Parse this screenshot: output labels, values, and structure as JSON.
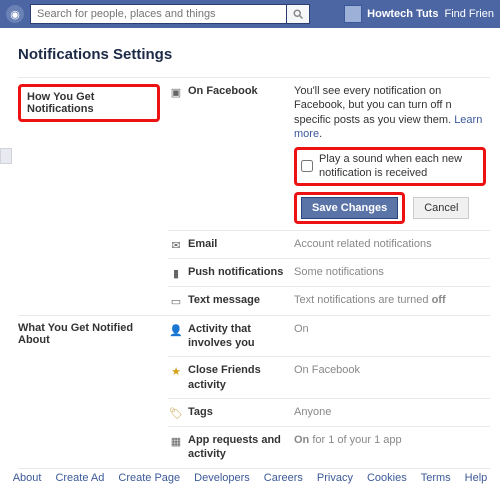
{
  "topbar": {
    "search_placeholder": "Search for people, places and things",
    "username": "Howtech Tuts",
    "find_friends": "Find Frien"
  },
  "page": {
    "title": "Notifications Settings"
  },
  "sections": {
    "how": {
      "title": "How You Get Notifications",
      "rows": {
        "on_fb": {
          "label": "On Facebook",
          "desc_prefix": "You'll see every notification on Facebook, but you can turn off n",
          "desc_suffix": "specific posts as you view them.",
          "learn_more": "Learn more",
          "sound_label": "Play a sound when each new notification is received",
          "save": "Save Changes",
          "cancel": "Cancel"
        },
        "email": {
          "label": "Email",
          "value": "Account related notifications"
        },
        "push": {
          "label": "Push notifications",
          "value": "Some notifications"
        },
        "sms": {
          "label": "Text message",
          "value_prefix": "Text notifications are turned ",
          "value_bold": "off"
        }
      }
    },
    "what": {
      "title": "What You Get Notified About",
      "rows": {
        "activity": {
          "label": "Activity that involves you",
          "value": "On"
        },
        "close_friends": {
          "label": "Close Friends activity",
          "value": "On Facebook"
        },
        "tags": {
          "label": "Tags",
          "value": "Anyone"
        },
        "apps": {
          "label": "App requests and activity",
          "value_prefix": "On ",
          "value_suffix": "for 1 of your 1 app"
        }
      }
    }
  },
  "footer": {
    "links": [
      "About",
      "Create Ad",
      "Create Page",
      "Developers",
      "Careers",
      "Privacy",
      "Cookies",
      "Terms",
      "Help"
    ]
  }
}
